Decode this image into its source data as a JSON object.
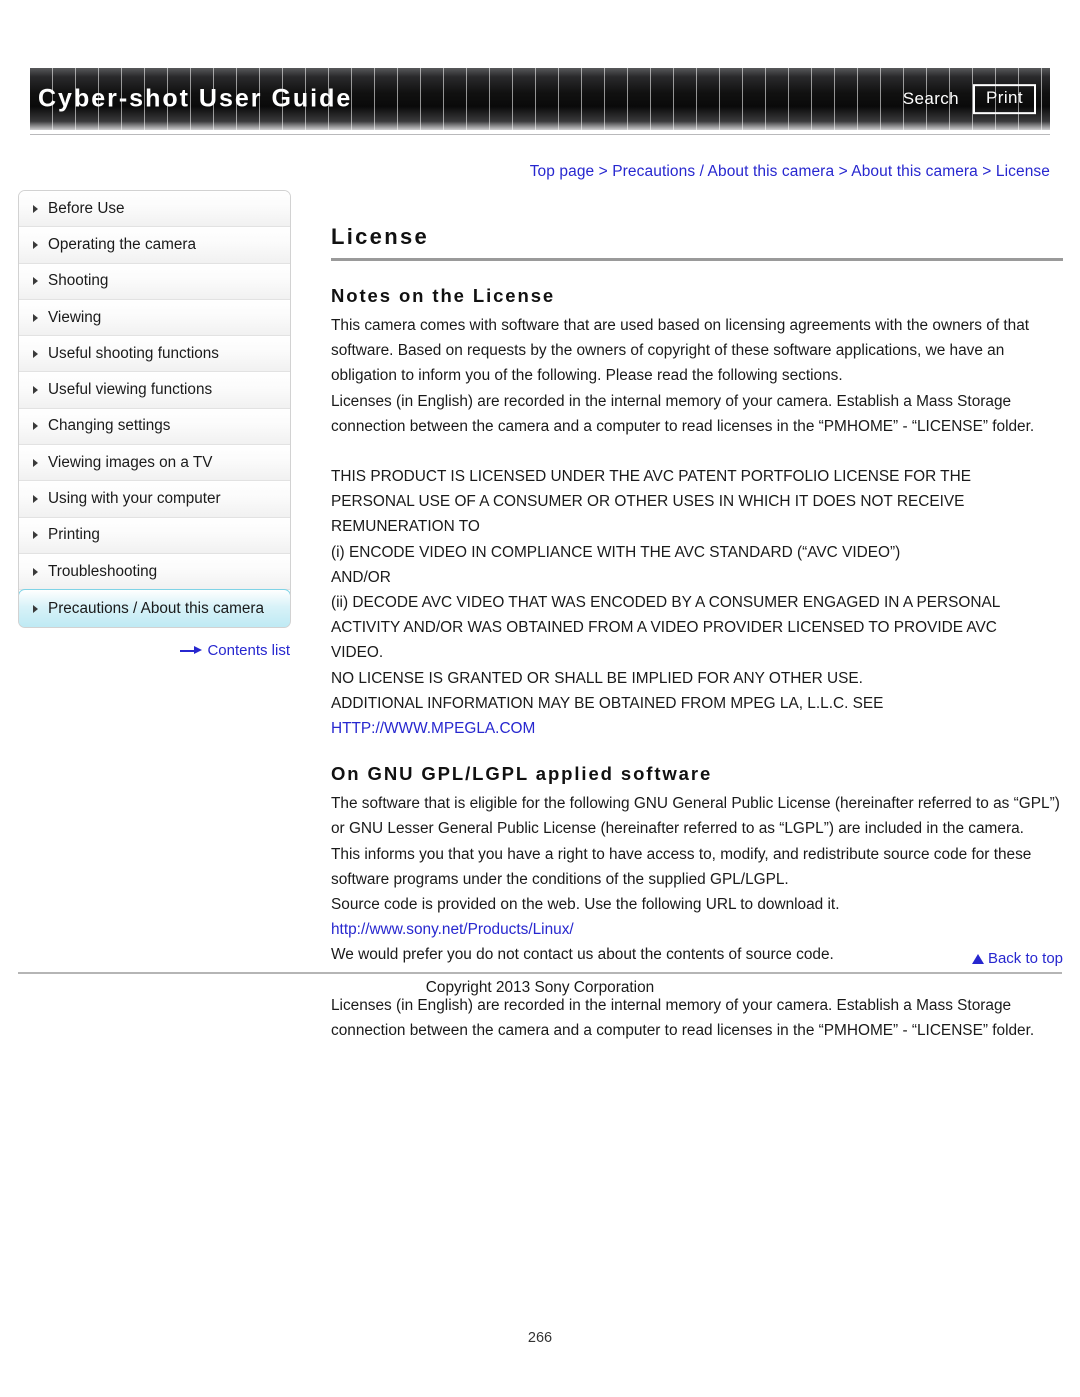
{
  "header": {
    "title": "Cyber-shot User Guide",
    "search_label": "Search",
    "print_label": "Print"
  },
  "breadcrumb": {
    "text": "Top page > Precautions / About this camera > About this camera > License"
  },
  "sidebar": {
    "items": [
      {
        "label": "Before Use"
      },
      {
        "label": "Operating the camera"
      },
      {
        "label": "Shooting"
      },
      {
        "label": "Viewing"
      },
      {
        "label": "Useful shooting functions"
      },
      {
        "label": "Useful viewing functions"
      },
      {
        "label": "Changing settings"
      },
      {
        "label": "Viewing images on a TV"
      },
      {
        "label": "Using with your computer"
      },
      {
        "label": "Printing"
      },
      {
        "label": "Troubleshooting"
      },
      {
        "label": "Precautions / About this camera"
      }
    ],
    "contents_list_label": "Contents list"
  },
  "main": {
    "page_title": "License",
    "notes_heading": "Notes on the License",
    "notes_paragraph_1": "This camera comes with software that are used based on licensing agreements with the owners of that software. Based on requests by the owners of copyright of these software applications, we have an obligation to inform you of the following. Please read the following sections.",
    "notes_paragraph_2": "Licenses (in English) are recorded in the internal memory of your camera. Establish a Mass Storage connection between the camera and a computer to read licenses in the “PMHOME” - “LICENSE” folder.",
    "avc_lines": [
      "THIS PRODUCT IS LICENSED UNDER THE AVC PATENT PORTFOLIO LICENSE FOR THE",
      "PERSONAL USE OF A CONSUMER OR OTHER USES IN WHICH IT DOES NOT RECEIVE",
      "REMUNERATION TO",
      "(i) ENCODE VIDEO IN COMPLIANCE WITH THE AVC STANDARD (“AVC VIDEO”)",
      "AND/OR",
      "(ii) DECODE AVC VIDEO THAT WAS ENCODED BY A CONSUMER ENGAGED IN A PERSONAL",
      "ACTIVITY AND/OR WAS OBTAINED FROM A VIDEO PROVIDER LICENSED TO PROVIDE AVC",
      "VIDEO.",
      "NO LICENSE IS GRANTED OR SHALL BE IMPLIED FOR ANY OTHER USE.",
      "ADDITIONAL INFORMATION MAY BE OBTAINED FROM MPEG LA, L.L.C. SEE"
    ],
    "mpegla_url": "HTTP://WWW.MPEGLA.COM",
    "gnu_heading": "On GNU GPL/LGPL applied software",
    "gnu_paragraph_1": "The software that is eligible for the following GNU General Public License (hereinafter referred to as “GPL”) or GNU Lesser General Public License (hereinafter referred to as “LGPL”) are included in the camera.",
    "gnu_paragraph_2": "This informs you that you have a right to have access to, modify, and redistribute source code for these software programs under the conditions of the supplied GPL/LGPL.",
    "gnu_paragraph_3": "Source code is provided on the web. Use the following URL to download it.",
    "sony_url": "http://www.sony.net/Products/Linux/",
    "gnu_paragraph_4": "We would prefer you do not contact us about the contents of source code.",
    "closing_paragraph": "Licenses (in English) are recorded in the internal memory of your camera. Establish a Mass Storage connection between the camera and a computer to read licenses in the “PMHOME” - “LICENSE” folder."
  },
  "footer": {
    "back_to_top_label": "Back to top",
    "copyright": "Copyright 2013 Sony Corporation",
    "page_number": "266"
  }
}
